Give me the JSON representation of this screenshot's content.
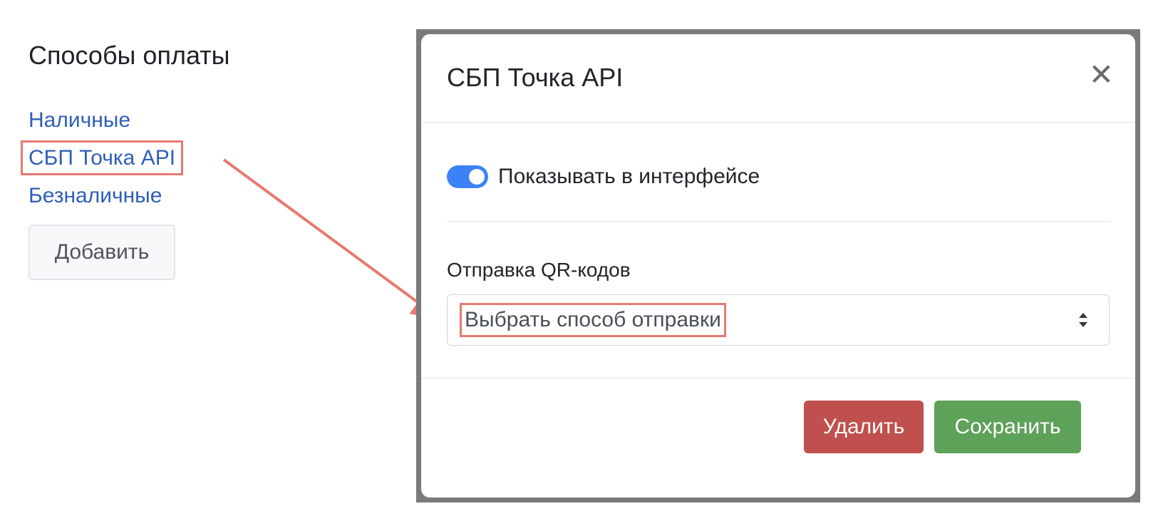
{
  "left": {
    "title": "Способы оплаты",
    "methods": [
      {
        "label": "Наличные",
        "highlighted": false
      },
      {
        "label": "СБП Точка API",
        "highlighted": true
      },
      {
        "label": "Безналичные",
        "highlighted": false
      }
    ],
    "add_button_label": "Добавить"
  },
  "modal": {
    "title": "СБП Точка API",
    "close_icon": "close-icon",
    "toggle": {
      "label": "Показывать в интерфейсе",
      "on": true
    },
    "qr_field": {
      "label": "Отправка QR-кодов",
      "selected": "Выбрать способ отправки"
    },
    "buttons": {
      "delete": "Удалить",
      "save": "Сохранить"
    }
  },
  "colors": {
    "link": "#2f5fb8",
    "annotation": "#e77a72",
    "toggle_on": "#3b82f6",
    "danger": "#c0504d",
    "success": "#5ea25a"
  }
}
